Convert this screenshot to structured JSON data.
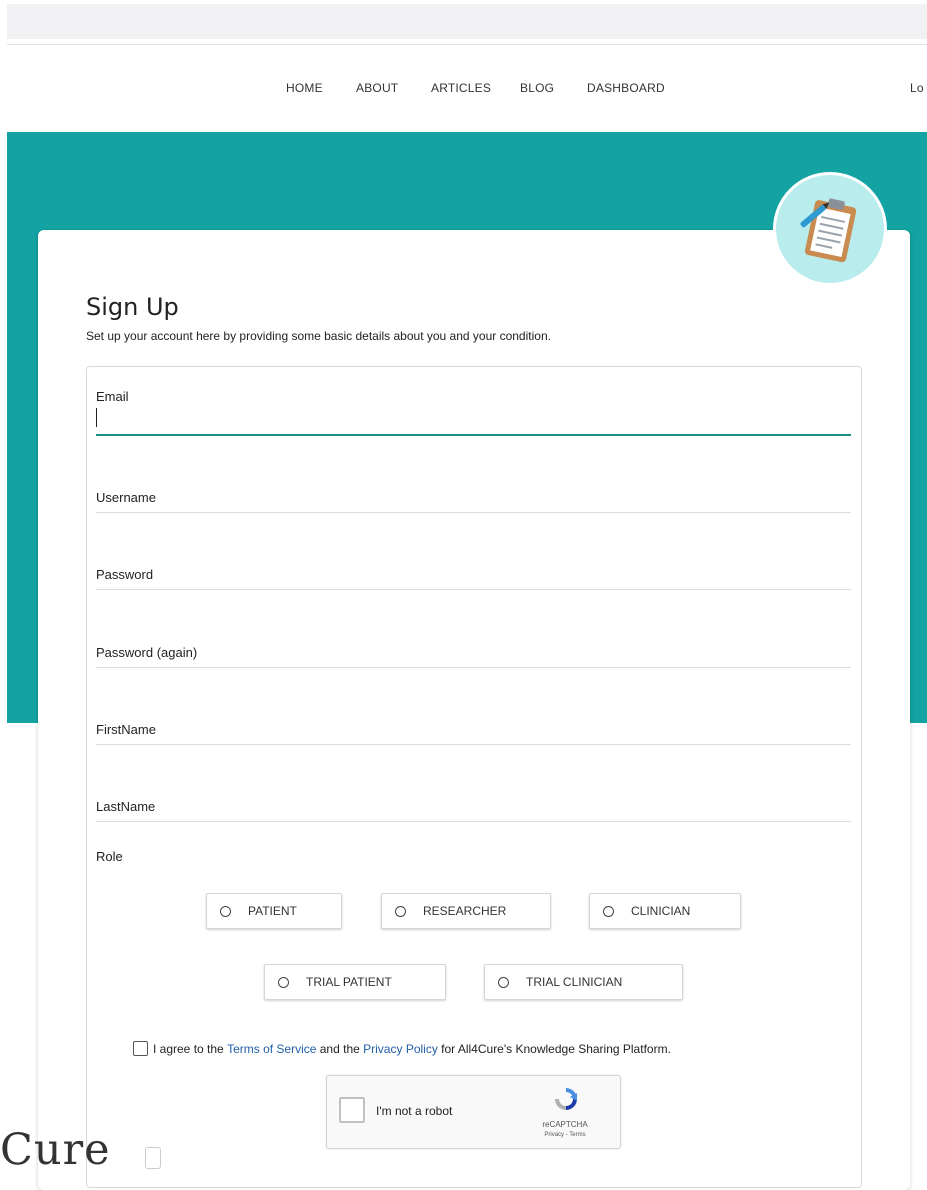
{
  "nav": {
    "items": [
      "HOME",
      "ABOUT",
      "ARTICLES",
      "BLOG",
      "DASHBOARD"
    ],
    "login_partial": "Lo"
  },
  "form": {
    "title": "Sign Up",
    "subtitle": "Set up your account here by providing some basic details about you and your condition.",
    "fields": [
      {
        "label": "Email",
        "value": ""
      },
      {
        "label": "Username",
        "value": ""
      },
      {
        "label": "Password",
        "value": ""
      },
      {
        "label": "Password (again)",
        "value": ""
      },
      {
        "label": "FirstName",
        "value": ""
      },
      {
        "label": "LastName",
        "value": ""
      }
    ],
    "role_label": "Role",
    "roles": [
      "PATIENT",
      "RESEARCHER",
      "CLINICIAN",
      "TRIAL PATIENT",
      "TRIAL CLINICIAN"
    ],
    "agree": {
      "prefix": "I agree to the ",
      "terms_link": "Terms of Service",
      "middle": " and the ",
      "privacy_link": "Privacy Policy",
      "suffix": " for All4Cure's Knowledge Sharing Platform."
    },
    "captcha": {
      "label": "I'm not a robot",
      "brand": "reCAPTCHA",
      "links": "Privacy - Terms"
    }
  },
  "footer": {
    "logo_partial": "Cure"
  },
  "colors": {
    "hero": "#13a3a2",
    "focus_underline": "#1c8f85",
    "link": "#1f5fa8"
  },
  "icons": {
    "avatar": "clipboard-icon"
  }
}
